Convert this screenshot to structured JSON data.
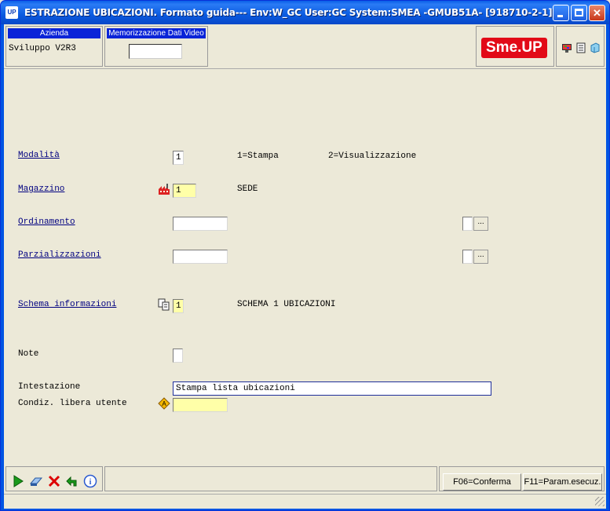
{
  "window": {
    "title": "ESTRAZIONE UBICAZIONI.  Formato guida--- Env:W_GC User:GC System:SMEA -GMUB51A- [918710-2-1]",
    "app_icon": "UP"
  },
  "header": {
    "azienda_label": "Azienda",
    "azienda_value": "Sviluppo V2R3",
    "memo_label": "Memorizzazione Dati Video",
    "memo_value": "",
    "logo_text_1": "Sme.",
    "logo_text_2": "UP"
  },
  "form": {
    "modalita": {
      "label": "Modalità",
      "value": "1",
      "opt1": "1=Stampa",
      "opt2": "2=Visualizzazione"
    },
    "magazzino": {
      "label": "Magazzino",
      "value": "1",
      "desc": "SEDE"
    },
    "ordinamento": {
      "label": "Ordinamento",
      "value": ""
    },
    "parzializzazioni": {
      "label": "Parzializzazioni",
      "value": ""
    },
    "schema": {
      "label": "Schema informazioni",
      "value": "1",
      "desc": "SCHEMA 1 UBICAZIONI"
    },
    "note": {
      "label": "Note"
    },
    "intestazione": {
      "label": "Intestazione",
      "value": "Stampa lista ubicazioni"
    },
    "condiz": {
      "label": "Condiz. libera utente",
      "value": ""
    }
  },
  "footer": {
    "f06": "F06=Conferma",
    "f11": "F11=Param.esecuz."
  },
  "colors": {
    "title_blue": "#0A5FE8",
    "label_blue": "#000080",
    "field_yellow": "#FFFFA8",
    "brand_red": "#E20A17"
  }
}
